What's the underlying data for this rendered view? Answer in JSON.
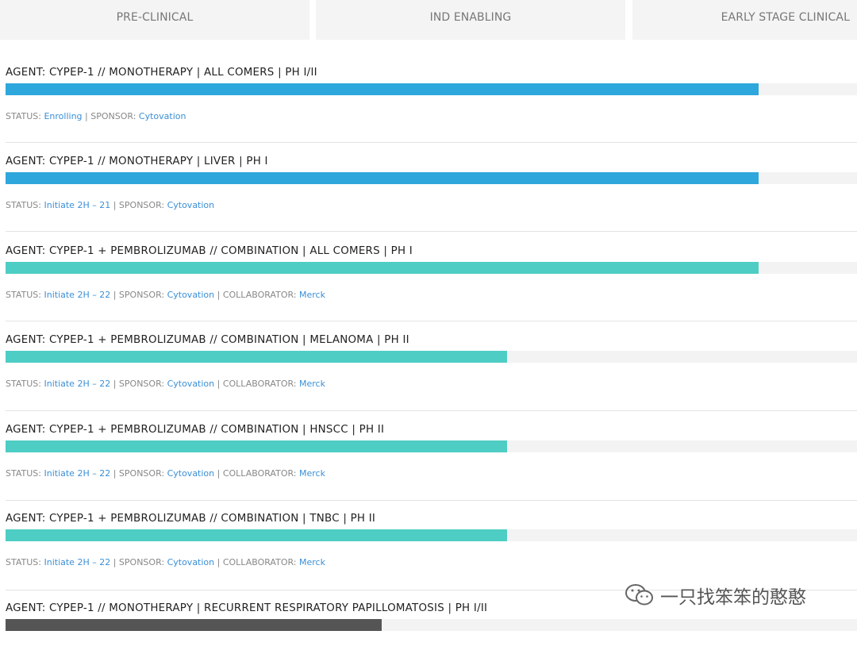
{
  "tabs": [
    {
      "label": "PRE-CLINICAL"
    },
    {
      "label": "IND ENABLING"
    },
    {
      "label": "EARLY STAGE CLINICAL"
    }
  ],
  "labels": {
    "status": "STATUS: ",
    "sponsor": "SPONSOR: ",
    "collaborator": "COLLABORATOR: ",
    "sep": " | "
  },
  "colors": {
    "blue": "#2ea7dc",
    "teal": "#4ecdc4",
    "gray": "#555555",
    "link": "#3b8fd6"
  },
  "trials": [
    {
      "title": "AGENT: CYPEP-1 // MONOTHERAPY | ALL COMERS | PH I/II",
      "progress_pct": 88.4,
      "color": "#2ea7dc",
      "status": "Enrolling",
      "sponsor": "Cytovation",
      "collaborator": null
    },
    {
      "title": "AGENT: CYPEP-1 // MONOTHERAPY | LIVER | PH I",
      "progress_pct": 88.4,
      "color": "#2ea7dc",
      "status": "Initiate 2H – 21",
      "sponsor": "Cytovation",
      "collaborator": null
    },
    {
      "title": "AGENT: CYPEP-1 + PEMBROLIZUMAB // COMBINATION | ALL COMERS | PH I",
      "progress_pct": 88.4,
      "color": "#4ecdc4",
      "status": "Initiate 2H – 22",
      "sponsor": "Cytovation",
      "collaborator": "Merck"
    },
    {
      "title": "AGENT: CYPEP-1 + PEMBROLIZUMAB // COMBINATION | MELANOMA | PH II",
      "progress_pct": 58.9,
      "color": "#4ecdc4",
      "status": "Initiate 2H – 22",
      "sponsor": "Cytovation",
      "collaborator": "Merck"
    },
    {
      "title": "AGENT: CYPEP-1 + PEMBROLIZUMAB // COMBINATION | HNSCC | PH II",
      "progress_pct": 58.9,
      "color": "#4ecdc4",
      "status": "Initiate 2H – 22",
      "sponsor": "Cytovation",
      "collaborator": "Merck"
    },
    {
      "title": "AGENT: CYPEP-1 + PEMBROLIZUMAB // COMBINATION | TNBC | PH II",
      "progress_pct": 58.9,
      "color": "#4ecdc4",
      "status": "Initiate 2H – 22",
      "sponsor": "Cytovation",
      "collaborator": "Merck"
    },
    {
      "title": "AGENT: CYPEP-1 // MONOTHERAPY | RECURRENT RESPIRATORY PAPILLOMATOSIS | PH I/II",
      "progress_pct": 44.2,
      "color": "#555555",
      "status": null,
      "sponsor": null,
      "collaborator": null
    }
  ],
  "watermark": {
    "text": "一只找笨笨的憨憨",
    "icon": "wechat-icon"
  }
}
